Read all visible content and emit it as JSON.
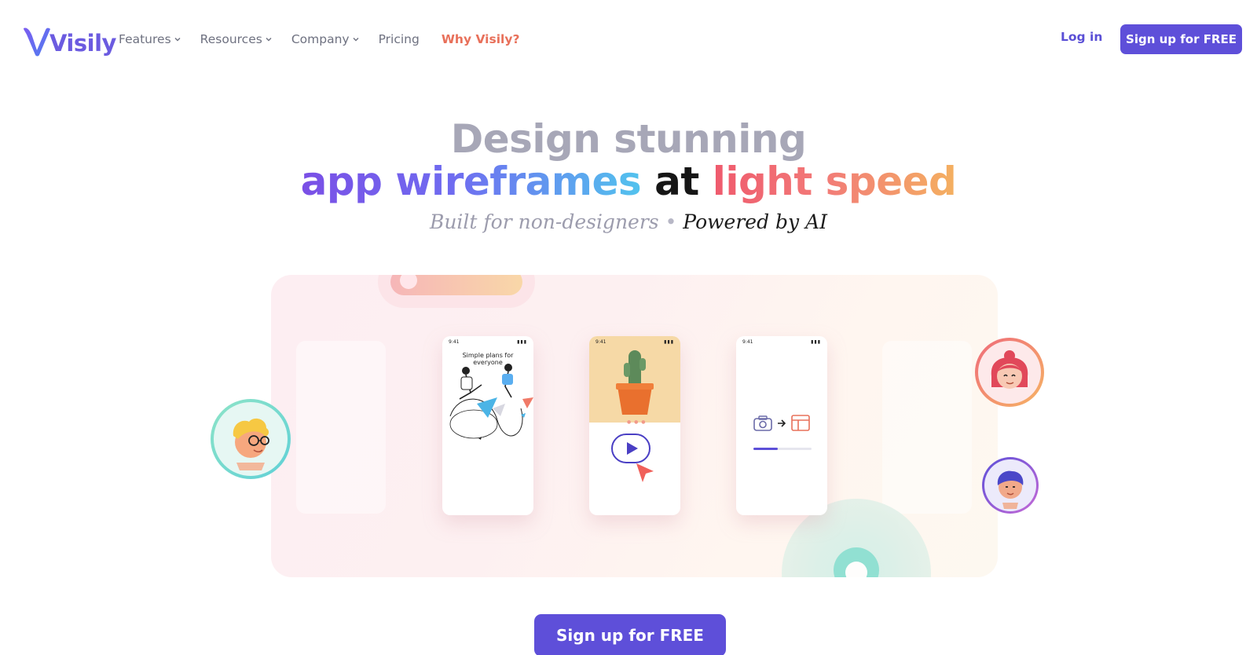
{
  "brand": {
    "name": "Visily",
    "color": "#6b5be0"
  },
  "nav": {
    "items": [
      {
        "label": "Features",
        "has_dropdown": true
      },
      {
        "label": "Resources",
        "has_dropdown": true
      },
      {
        "label": "Company",
        "has_dropdown": true
      },
      {
        "label": "Pricing",
        "has_dropdown": false
      },
      {
        "label": "Why Visily?",
        "has_dropdown": false,
        "highlight": true
      }
    ],
    "login_label": "Log in",
    "signup_label": "Sign up for FREE"
  },
  "hero": {
    "line1": "Design stunning",
    "line2_a": "app wireframes",
    "line2_b": "at",
    "line2_c": "light speed",
    "tagline_a": "Built for non-designers",
    "tagline_sep": "•",
    "tagline_b": "Powered by AI"
  },
  "showcase": {
    "phone1": {
      "time": "9:41",
      "title": "Simple plans for everyone"
    },
    "phone2": {
      "time": "9:41"
    },
    "phone3": {
      "time": "9:41",
      "progress": 0.42
    }
  },
  "cta": {
    "label": "Sign up for FREE"
  },
  "colors": {
    "primary": "#5e4fd9",
    "accent_orange": "#e8705a",
    "heading_gray": "#a7a7b7"
  },
  "icons": [
    "logo-v-icon",
    "chevron-down-icon",
    "camera-icon",
    "arrow-right-icon",
    "layout-icon",
    "play-icon",
    "cursor-icon"
  ]
}
